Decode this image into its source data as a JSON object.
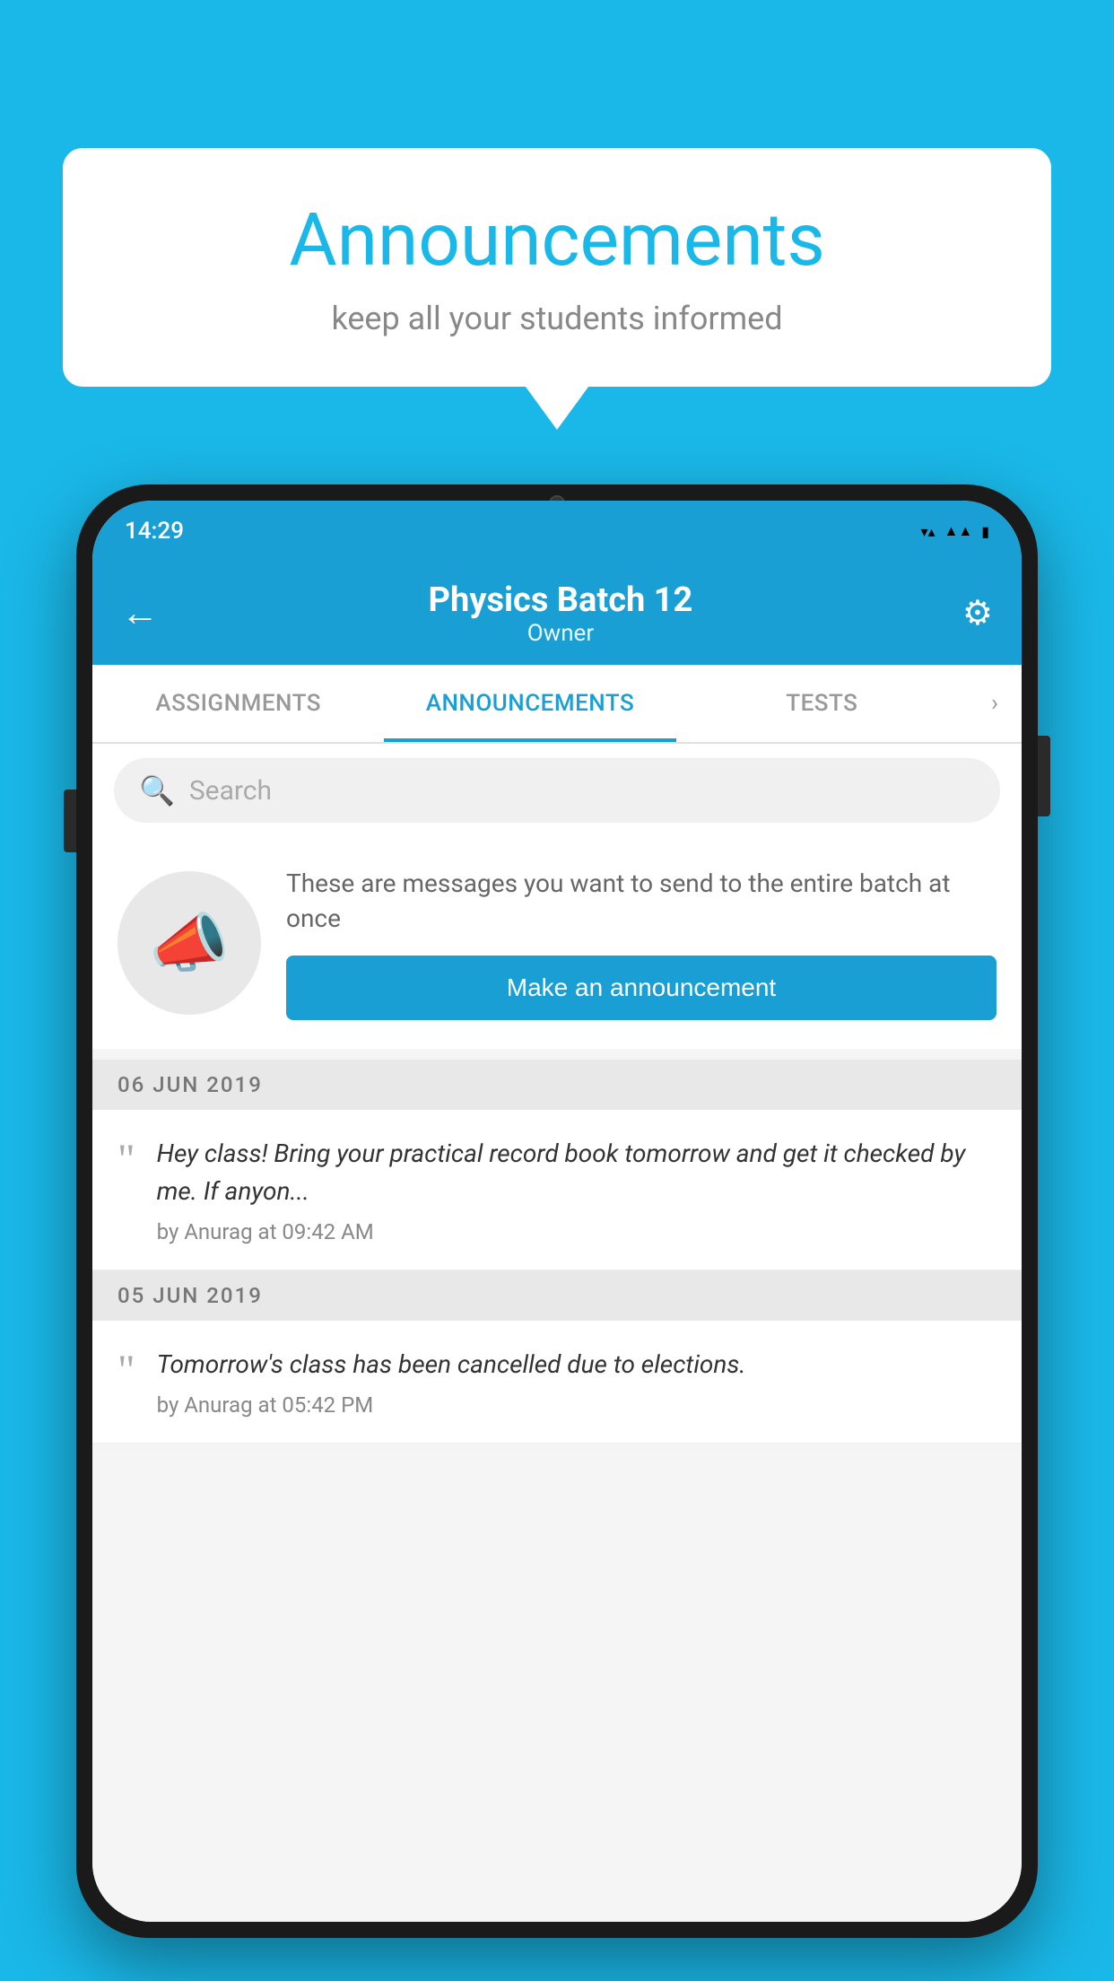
{
  "background_color": "#1ab8e8",
  "speech_bubble": {
    "title": "Announcements",
    "subtitle": "keep all your students informed"
  },
  "phone": {
    "status_bar": {
      "time": "14:29",
      "icons": [
        "wifi",
        "signal",
        "battery"
      ]
    },
    "header": {
      "back_label": "←",
      "title": "Physics Batch 12",
      "subtitle": "Owner",
      "gear_label": "⚙"
    },
    "tabs": [
      {
        "label": "ASSIGNMENTS",
        "active": false
      },
      {
        "label": "ANNOUNCEMENTS",
        "active": true
      },
      {
        "label": "TESTS",
        "active": false
      }
    ],
    "tabs_more": "›",
    "search": {
      "placeholder": "Search"
    },
    "promo": {
      "description": "These are messages you want to send to the entire batch at once",
      "button_label": "Make an announcement"
    },
    "announcements": [
      {
        "date": "06  JUN  2019",
        "text": "Hey class! Bring your practical record book tomorrow and get it checked by me. If anyon...",
        "meta": "by Anurag at 09:42 AM"
      },
      {
        "date": "05  JUN  2019",
        "text": "Tomorrow's class has been cancelled due to elections.",
        "meta": "by Anurag at 05:42 PM"
      }
    ]
  }
}
